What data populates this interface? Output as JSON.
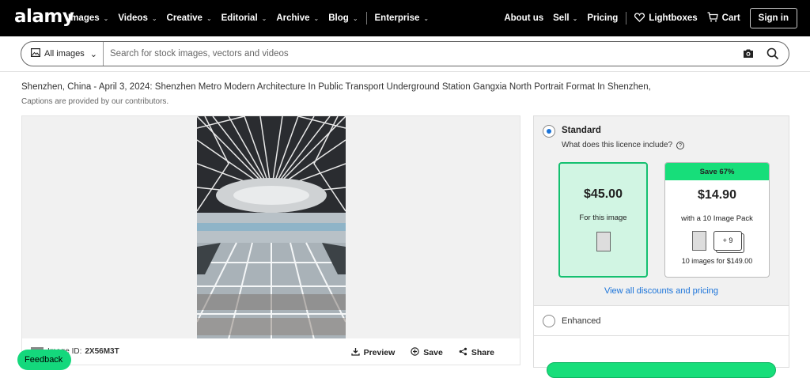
{
  "header": {
    "logo": "alamy",
    "nav": [
      {
        "label": "Images"
      },
      {
        "label": "Videos"
      },
      {
        "label": "Creative"
      },
      {
        "label": "Editorial"
      },
      {
        "label": "Archive"
      },
      {
        "label": "Blog"
      }
    ],
    "enterprise": "Enterprise",
    "about": "About us",
    "sell": "Sell",
    "pricing": "Pricing",
    "lightboxes": "Lightboxes",
    "cart": "Cart",
    "signin": "Sign in"
  },
  "search": {
    "scope": "All images",
    "placeholder": "Search for stock images, vectors and videos"
  },
  "page": {
    "title": "Shenzhen, China - April 3, 2024: Shenzhen Metro Modern Architecture In Public Transport Underground Station Gangxia North Portrait Format In Shenzhen,",
    "caption_note": "Captions are provided by our contributors."
  },
  "image_footer": {
    "id_label": "Image ID:",
    "id_value": "2X56M3T",
    "preview": "Preview",
    "save": "Save",
    "share": "Share"
  },
  "licence": {
    "standard_label": "Standard",
    "standard_question": "What does this licence include?",
    "single": {
      "price": "$45.00",
      "desc": "For this image"
    },
    "pack": {
      "badge": "Save 67%",
      "price": "$14.90",
      "desc": "with a 10 Image Pack",
      "plus": "+ 9",
      "note": "10 images for $149.00"
    },
    "view_all": "View all discounts and pricing",
    "enhanced_label": "Enhanced"
  },
  "feedback": "Feedback"
}
